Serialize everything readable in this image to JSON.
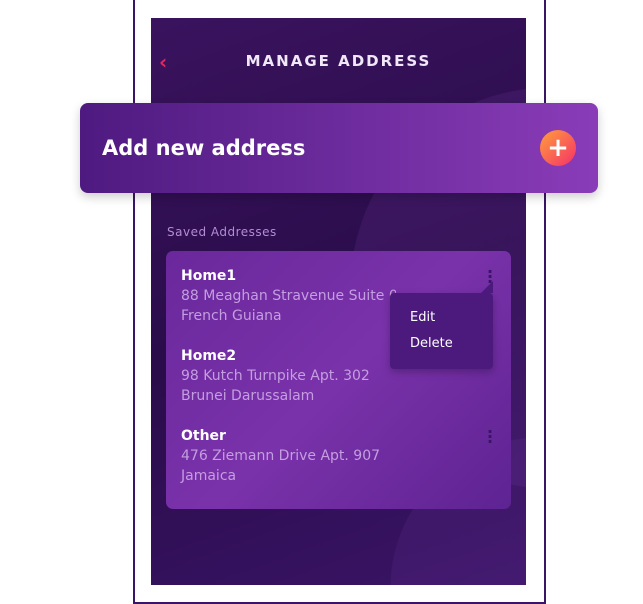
{
  "header": {
    "title": "MANAGE ADDRESS",
    "back_icon": "chevron-left-icon"
  },
  "add_bar": {
    "label": "Add new address",
    "icon": "plus-icon"
  },
  "saved_label": "Saved Addresses",
  "addresses": [
    {
      "name": "Home1",
      "line1": "88 Meaghan Stravenue Suite 033",
      "line2": "French Guiana"
    },
    {
      "name": "Home2",
      "line1": "98 Kutch Turnpike Apt. 302",
      "line2": "Brunei Darussalam"
    },
    {
      "name": "Other",
      "line1": "476 Ziemann Drive Apt. 907",
      "line2": "Jamaica"
    }
  ],
  "context_menu": {
    "edit": "Edit",
    "delete": "Delete"
  },
  "colors": {
    "accent": "#e8265e",
    "card": "#7a32aa",
    "background": "#2a0c4a"
  }
}
